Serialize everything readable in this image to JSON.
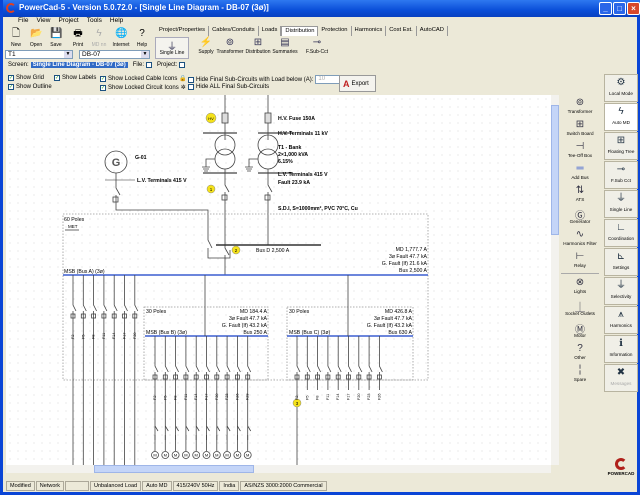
{
  "window": {
    "title": "PowerCad-5 - Version 5.0.72.0 - [Single Line Diagram - DB-07 (3ø)]"
  },
  "menu": [
    "File",
    "View",
    "Project",
    "Tools",
    "Help"
  ],
  "toolbar": [
    {
      "label": "New",
      "icon": "new-file-icon"
    },
    {
      "label": "Open",
      "icon": "open-folder-icon"
    },
    {
      "label": "Save",
      "icon": "save-icon"
    },
    {
      "label": "Print",
      "icon": "printer-icon"
    },
    {
      "label": "MD nn",
      "icon": "lightning-icon"
    },
    {
      "label": "Internet",
      "icon": "globe-icon"
    },
    {
      "label": "Help",
      "icon": "help-icon"
    }
  ],
  "combos": {
    "transformer": "T1",
    "board": "DB-07"
  },
  "tabs": [
    "Project/Properties",
    "Cables/Conduits",
    "Loads",
    "Distribution",
    "Protection",
    "Harmonics",
    "Cost Est.",
    "AutoCAD"
  ],
  "active_tab": "Distribution",
  "subtools": [
    "Single Line",
    "Supply",
    "Transformer",
    "Distribution",
    "Summaries",
    "F.Sub-Cct"
  ],
  "screen": {
    "label": "Screen:",
    "value": "Single Line Diagram - DB-07 (3ø)",
    "file": "File:",
    "project": "Project:"
  },
  "options": {
    "show_grid": "Show Grid",
    "show_outline": "Show Outline",
    "show_labels": "Show Labels",
    "locked_cable": "Show Locked Cable Icons",
    "locked_circuit": "Show Locked Circuit Icons",
    "hide_below": "Hide Final Sub-Circuits with Load below (A):",
    "hide_below_value": "10",
    "hide_all": "Hide ALL Final Sub-Circuits",
    "export": "Export"
  },
  "palette": [
    "Transformer",
    "Switch Board",
    "Tee-Off Box",
    "Add Bus",
    "ATS",
    "Generator",
    "Harmonics Filter",
    "Relay",
    "Lights",
    "Socket Outlets",
    "Motor",
    "Other",
    "Spare"
  ],
  "right_panel": [
    "Local Mode",
    "Auto MD",
    "Floating Tree",
    "F.Sub Cct",
    "Single Line",
    "Coordination",
    "Settings",
    "Selectivity",
    "Harmonics",
    "Information",
    "Messages"
  ],
  "diagram": {
    "hv_marker": "HV",
    "hv_fuse": "H.V. Fuse 150A",
    "hv_terminals": "H.V. Terminals 11 kV",
    "t1_name": "T1 - Bank",
    "t1_rating": "2×1,000 kVA",
    "t1_imp": "6.15%",
    "lv_terminals": "L.V. Terminals 415 V",
    "lv_fault": "Fault 23.9 kA",
    "gen_name": "G-01",
    "gen_symbol": "G",
    "gen_lv": "L.V. Terminals 415 V",
    "marker1": "1",
    "marker2": "2",
    "marker3": "3",
    "cable": "S.D.I, S=1000mm², PVC 70°C, Cu",
    "bus_d": "Bus D 2,500 A",
    "bus_a": {
      "poles": "60 Poles",
      "met": "MET",
      "name": "MSB (Bus A) (3ø)",
      "md": "MD 1,777.7 A",
      "fault": "3ø Fault 47.7 kA",
      "gfault": "G. Fault (If) 21.6 kA",
      "bus": "Bus 2,500 A"
    },
    "bus_b": {
      "poles": "30 Poles",
      "name": "MSB (Bus B) (3ø)",
      "md": "MD 184.4 A",
      "fault": "3ø Fault 47.7 kA",
      "gfault": "G. Fault (If) 43.2 kA",
      "bus": "Bus 250 A",
      "circuits": [
        "F2",
        "F5",
        "F8",
        "F11",
        "F14",
        "F17",
        "F20",
        "F23",
        "F26",
        "F29"
      ]
    },
    "bus_c": {
      "poles": "30 Poles",
      "name": "MSB (Bus C) (3ø)",
      "md": "MD 426.8 A",
      "fault": "3ø Fault 47.7 kA",
      "gfault": "G. Fault (If) 43.2 kA",
      "bus": "Bus 630 A",
      "circuits": [
        "F2",
        "F5",
        "F8",
        "F11",
        "F14",
        "F17",
        "F20",
        "F23",
        "F26"
      ]
    },
    "bus_a_circuits": [
      "F2",
      "F5",
      "F8",
      "F11",
      "F14",
      "F17",
      "F20"
    ],
    "motor": "M"
  },
  "status": [
    "Modified",
    "Network",
    "",
    "Unbalanced Load",
    "Auto MD",
    "415/240V 50Hz",
    "India",
    "AS/NZS 3000:2000 Commercial"
  ],
  "brand": "POWERCAD"
}
